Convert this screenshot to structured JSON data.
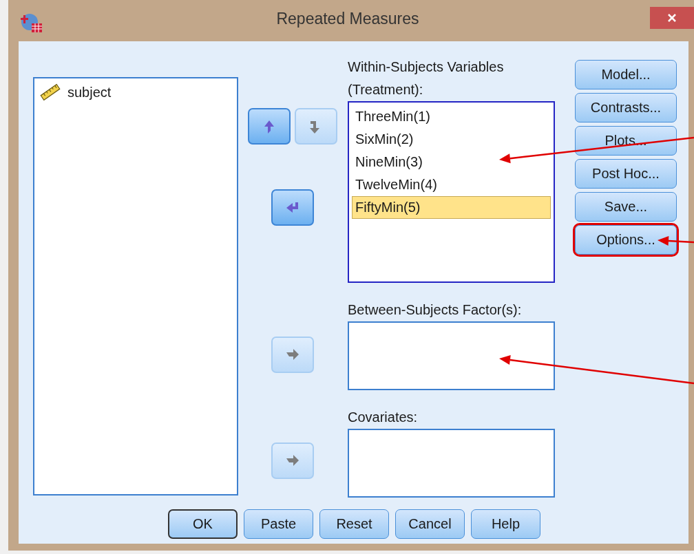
{
  "window": {
    "title": "Repeated Measures"
  },
  "source_variables": [
    {
      "label": "subject"
    }
  ],
  "move_buttons": [
    {
      "kind": "up",
      "disabled": false
    },
    {
      "kind": "down",
      "disabled": true
    },
    {
      "kind": "left",
      "disabled": false
    },
    {
      "kind": "right",
      "disabled": true
    },
    {
      "kind": "right",
      "disabled": true
    }
  ],
  "within_subjects": {
    "label": "Within-Subjects Variables",
    "factor": "(Treatment):",
    "items": [
      {
        "label": "ThreeMin(1)",
        "selected": false
      },
      {
        "label": "SixMin(2)",
        "selected": false
      },
      {
        "label": "NineMin(3)",
        "selected": false
      },
      {
        "label": "TwelveMin(4)",
        "selected": false
      },
      {
        "label": "FiftyMin(5)",
        "selected": true
      }
    ]
  },
  "between_subjects": {
    "label": "Between-Subjects Factor(s):"
  },
  "covariates": {
    "label": "Covariates:"
  },
  "side_buttons": [
    {
      "label": "Model...",
      "highlighted": false
    },
    {
      "label": "Contrasts...",
      "highlighted": false
    },
    {
      "label": "Plots...",
      "highlighted": false
    },
    {
      "label": "Post Hoc...",
      "highlighted": false
    },
    {
      "label": "Save...",
      "highlighted": false
    },
    {
      "label": "Options...",
      "highlighted": true
    }
  ],
  "dialog_buttons": [
    {
      "label": "OK",
      "default": true
    },
    {
      "label": "Paste",
      "default": false
    },
    {
      "label": "Reset",
      "default": false
    },
    {
      "label": "Cancel",
      "default": false
    },
    {
      "label": "Help",
      "default": false
    }
  ]
}
